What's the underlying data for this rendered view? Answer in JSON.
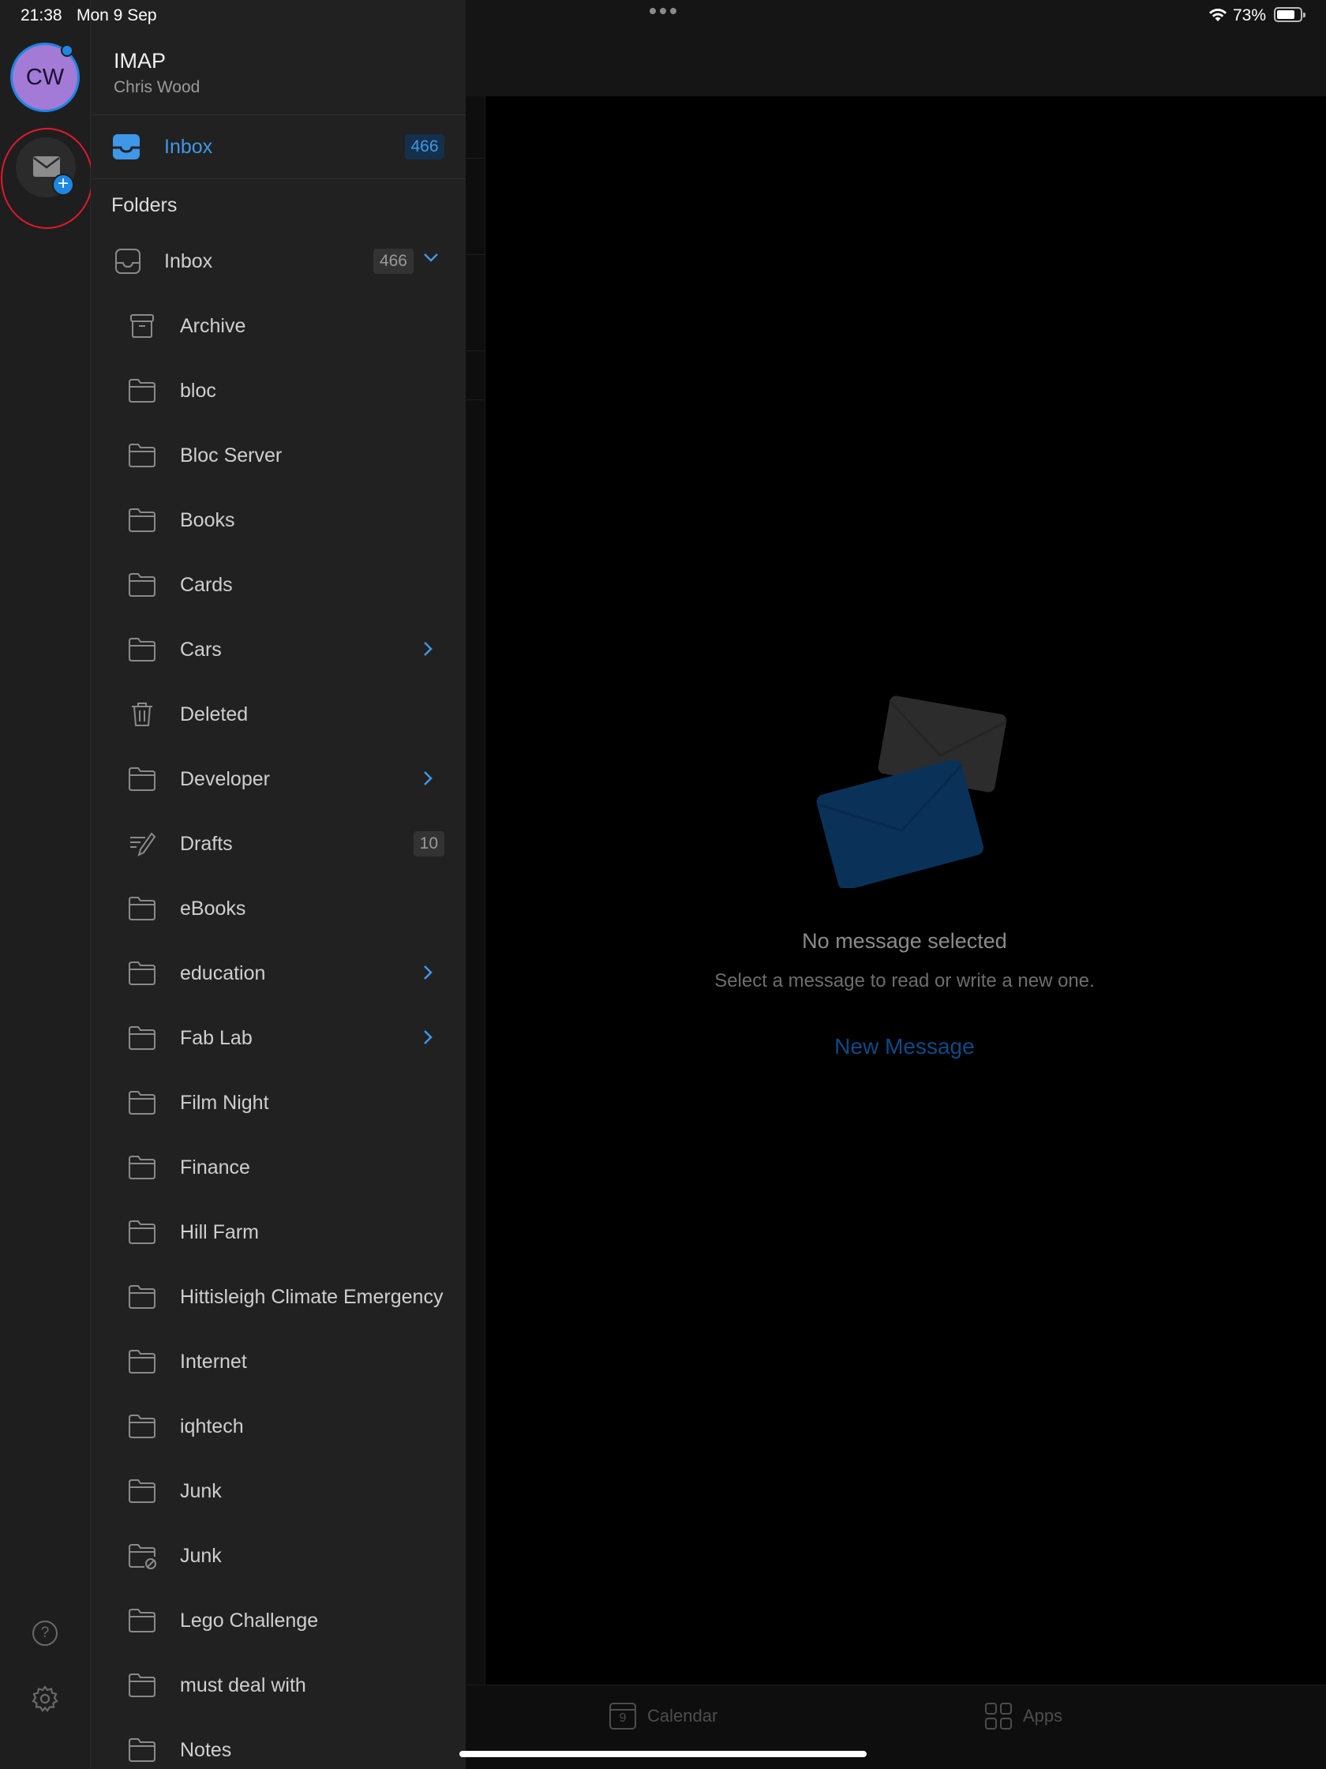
{
  "status_bar": {
    "time": "21:38",
    "date": "Mon 9 Sep",
    "battery": "73%",
    "battery_level": 0.73
  },
  "account": {
    "initials": "CW",
    "type": "IMAP",
    "user_name": "Chris Wood"
  },
  "favorites": {
    "inbox_label": "Inbox",
    "inbox_count": "466"
  },
  "folders_title": "Folders",
  "folders": [
    {
      "label": "Inbox",
      "count": "466",
      "icon": "inbox-icon",
      "chevron": "chevron-down-icon",
      "top": true
    },
    {
      "label": "Archive",
      "count": "",
      "icon": "archive-icon",
      "chevron": ""
    },
    {
      "label": "bloc",
      "count": "",
      "icon": "folder-icon",
      "chevron": ""
    },
    {
      "label": "Bloc Server",
      "count": "",
      "icon": "folder-icon",
      "chevron": ""
    },
    {
      "label": "Books",
      "count": "",
      "icon": "folder-icon",
      "chevron": ""
    },
    {
      "label": "Cards",
      "count": "",
      "icon": "folder-icon",
      "chevron": ""
    },
    {
      "label": "Cars",
      "count": "",
      "icon": "folder-icon",
      "chevron": "chevron-right-icon"
    },
    {
      "label": "Deleted",
      "count": "",
      "icon": "trash-icon",
      "chevron": ""
    },
    {
      "label": "Developer",
      "count": "",
      "icon": "folder-icon",
      "chevron": "chevron-right-icon"
    },
    {
      "label": "Drafts",
      "count": "10",
      "icon": "drafts-icon",
      "chevron": ""
    },
    {
      "label": "eBooks",
      "count": "",
      "icon": "folder-icon",
      "chevron": ""
    },
    {
      "label": "education",
      "count": "",
      "icon": "folder-icon",
      "chevron": "chevron-right-icon"
    },
    {
      "label": "Fab Lab",
      "count": "",
      "icon": "folder-icon",
      "chevron": "chevron-right-icon"
    },
    {
      "label": "Film Night",
      "count": "",
      "icon": "folder-icon",
      "chevron": ""
    },
    {
      "label": "Finance",
      "count": "",
      "icon": "folder-icon",
      "chevron": ""
    },
    {
      "label": "Hill Farm",
      "count": "",
      "icon": "folder-icon",
      "chevron": ""
    },
    {
      "label": "Hittisleigh Climate Emergency",
      "count": "",
      "icon": "folder-icon",
      "chevron": ""
    },
    {
      "label": "Internet",
      "count": "",
      "icon": "folder-icon",
      "chevron": ""
    },
    {
      "label": "iqhtech",
      "count": "",
      "icon": "folder-icon",
      "chevron": ""
    },
    {
      "label": "Junk",
      "count": "",
      "icon": "folder-icon",
      "chevron": ""
    },
    {
      "label": "Junk",
      "count": "",
      "icon": "junk-folder-icon",
      "chevron": ""
    },
    {
      "label": "Lego Challenge",
      "count": "",
      "icon": "folder-icon",
      "chevron": ""
    },
    {
      "label": "must deal with",
      "count": "",
      "icon": "folder-icon",
      "chevron": ""
    },
    {
      "label": "Notes",
      "count": "",
      "icon": "folder-icon",
      "chevron": ""
    }
  ],
  "empty_state": {
    "title": "No message selected",
    "subtitle": "Select a message to read or write a new one.",
    "action": "New Message"
  },
  "tabs": {
    "calendar_label": "Calendar",
    "calendar_day": "9",
    "apps_label": "Apps"
  },
  "colors": {
    "accent": "#1e86e3",
    "highlight_ring": "#e0192c",
    "avatar": "#a37ad6"
  }
}
